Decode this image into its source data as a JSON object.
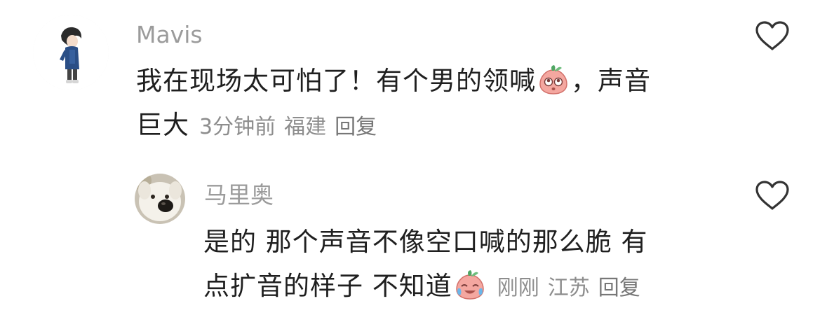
{
  "comments": [
    {
      "username": "Mavis",
      "text_line1_a": "我在现场太可怕了！有个男的领喊",
      "emoji": "surprised-peach-emoji",
      "text_line1_b": "，声音",
      "text_line2": "巨大",
      "time": "3分钟前",
      "location": "福建",
      "reply_label": "回复",
      "like_icon": "heart-outline-icon"
    },
    {
      "username": "马里奥",
      "text_line1": "是的 那个声音不像空口喊的那么脆 有",
      "text_line2": "点扩音的样子 不知道",
      "emoji": "crying-laughing-peach-emoji",
      "time": "刚刚",
      "location": "江苏",
      "reply_label": "回复",
      "like_icon": "heart-outline-icon"
    }
  ],
  "colors": {
    "username": "#9b9b9b",
    "text": "#1f1f1f",
    "meta": "#8d8d8d",
    "icon": "#333333"
  }
}
